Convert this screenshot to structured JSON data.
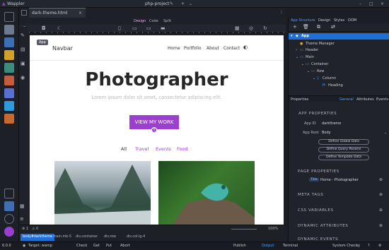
{
  "app": {
    "name": "Wappler",
    "project": "php-project",
    "version": "6.0.0"
  },
  "tabs": {
    "active": "dark-theme.html"
  },
  "design_modes": [
    "Design",
    "Code",
    "Split"
  ],
  "canvas": {
    "tooltip": "App",
    "navbar": {
      "brand": "Navbar",
      "links": [
        "Home",
        "Portfolio",
        "About",
        "Contact"
      ]
    },
    "hero": {
      "title": "Photographer",
      "subtitle": "Lorem ipsum dolor sit amet, consectetur adipiscing elit.",
      "button": "VIEW MY WORK"
    },
    "filters": [
      "All",
      "Travel",
      "Events",
      "Food"
    ]
  },
  "statusbar": {
    "errors": "1",
    "warnings": "0",
    "zoom": "100%"
  },
  "breadcrumbs": [
    "body#darktheme",
    "main.mb-5",
    "div.container",
    "div.row",
    "div.col-lg-4"
  ],
  "bottombar": {
    "target": "Target: wamp",
    "check": "Check",
    "get": "Get",
    "put": "Put",
    "abort": "Abort",
    "publish": "Publish",
    "output": "Output",
    "terminal": "Terminal",
    "system_check": "System Check"
  },
  "right": {
    "tabs": [
      "App Structure",
      "Design",
      "Styles",
      "DOM"
    ],
    "tree": [
      {
        "label": "App",
        "level": 0
      },
      {
        "label": "Theme Manager",
        "level": 1
      },
      {
        "label": "Header",
        "level": 1
      },
      {
        "label": "Main",
        "level": 1
      },
      {
        "label": "Container",
        "level": 2
      },
      {
        "label": "Row",
        "level": 3
      },
      {
        "label": "Column",
        "level": 4
      },
      {
        "label": "Heading",
        "level": 5
      }
    ],
    "prop_tabs": [
      "Properties",
      "General",
      "Attributes",
      "Events"
    ],
    "app_properties": {
      "title": "APP PROPERTIES",
      "app_id_label": "App ID",
      "app_id_value": "darktheme",
      "app_root_label": "App Root",
      "app_root_value": "Body",
      "buttons": [
        "Define Global Data",
        "Define Query Params",
        "Define Template Data"
      ]
    },
    "page_properties": {
      "title": "PAGE PROPERTIES",
      "title_label": "Title",
      "title_value": "Home - Photographer"
    },
    "sections": [
      "META TAGS",
      "CSS VARIABLES",
      "DYNAMIC ATTRIBUTES",
      "DYNAMIC EVENTS"
    ]
  },
  "colors": {
    "accent": "#9b3fd0",
    "selection": "#1e6fd8",
    "link": "#9b3fd0"
  }
}
